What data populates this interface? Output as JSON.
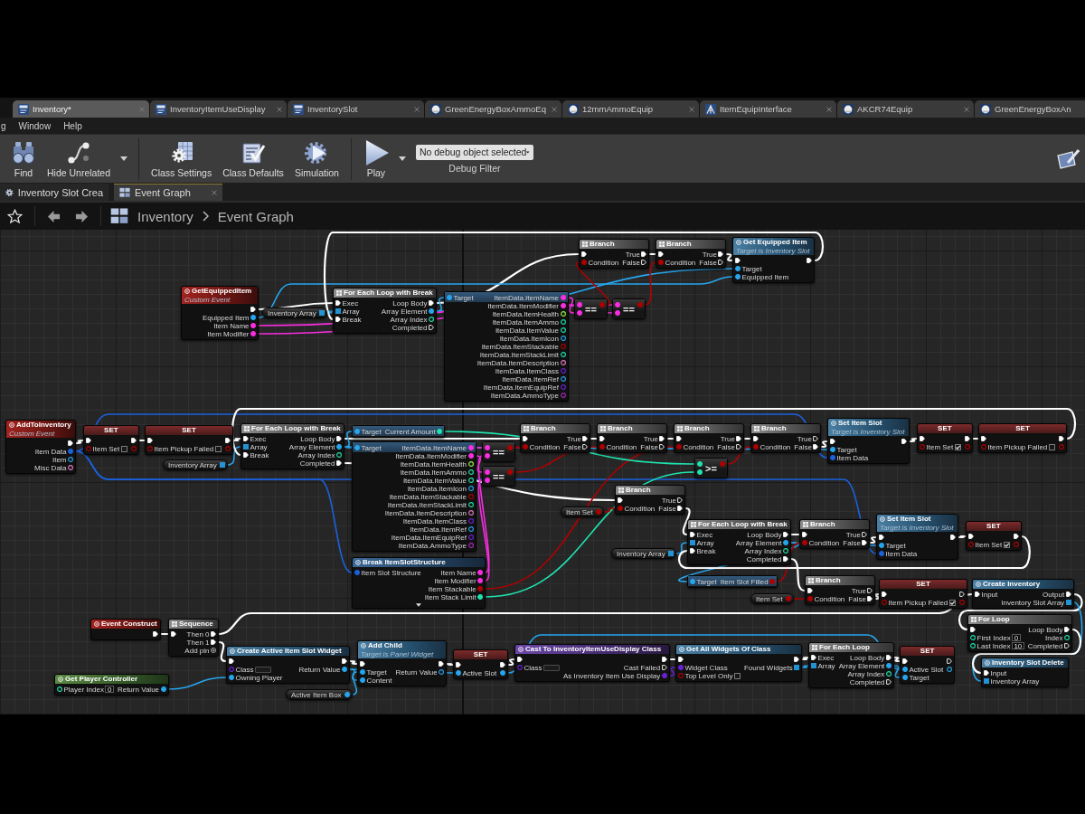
{
  "document_tabs": [
    {
      "label": "Inventory*",
      "kind": "blueprint",
      "selected": true
    },
    {
      "label": "InventoryItemUseDisplay",
      "kind": "blueprint",
      "selected": false
    },
    {
      "label": "InventorySlot",
      "kind": "blueprint",
      "selected": false
    },
    {
      "label": "GreenEnergyBoxAmmoEq",
      "kind": "asset",
      "selected": false
    },
    {
      "label": "12mmAmmoEquip",
      "kind": "asset",
      "selected": false
    },
    {
      "label": "ItemEquipInterface",
      "kind": "interface",
      "selected": false
    },
    {
      "label": "AKCR74Equip",
      "kind": "asset",
      "selected": false
    },
    {
      "label": "GreenEnergyBoxAn",
      "kind": "asset",
      "selected": false
    }
  ],
  "menu": [
    "g",
    "Window",
    "Help"
  ],
  "toolbar": {
    "groups": [
      [
        {
          "kind": "find",
          "label": "Find"
        },
        {
          "kind": "hide-unrelated",
          "label": "Hide Unrelated"
        },
        {
          "kind": "caret"
        }
      ],
      [
        {
          "kind": "class-settings",
          "label": "Class Settings"
        },
        {
          "kind": "class-defaults",
          "label": "Class Defaults"
        },
        {
          "kind": "simulation",
          "label": "Simulation"
        }
      ],
      [
        {
          "kind": "play",
          "label": "Play"
        },
        {
          "kind": "caret"
        }
      ]
    ],
    "debug_filter": {
      "value": "No debug object selected",
      "label": "Debug Filter"
    },
    "trailing": [
      {
        "kind": "edit"
      }
    ]
  },
  "editor_tabs": [
    {
      "label": "Inventory Slot Crea",
      "kind": "function",
      "selected": false
    },
    {
      "label": "Event Graph",
      "kind": "graph",
      "selected": true
    }
  ],
  "breadcrumb": [
    "Inventory",
    "Event Graph"
  ],
  "graph": {
    "nodes": [
      {
        "kind": "flow",
        "title": "Branch",
        "inputs": [
          {
            "kind": "exec",
            "linked": true
          },
          {
            "label": "Condition",
            "kind": "bool",
            "linked": true
          }
        ],
        "outputs": [
          {
            "label": "True",
            "kind": "exec",
            "linked": true
          },
          {
            "label": "False",
            "kind": "exec",
            "linked": false
          }
        ]
      },
      {
        "kind": "flow",
        "title": "Branch",
        "inputs": [
          {
            "kind": "exec",
            "linked": true
          },
          {
            "label": "Condition",
            "kind": "bool",
            "linked": true
          }
        ],
        "outputs": [
          {
            "label": "True",
            "kind": "exec",
            "linked": true
          },
          {
            "label": "False",
            "kind": "exec",
            "linked": false
          }
        ]
      },
      {
        "kind": "function",
        "title": "Get Equipped Item",
        "subtitle": "Target is Inventory Slot",
        "inputs": [
          {
            "kind": "exec",
            "linked": true
          },
          {
            "label": "Target",
            "kind": "object",
            "linked": true
          },
          {
            "label": "Equipped Item",
            "kind": "object",
            "linked": true
          }
        ],
        "outputs": [
          {
            "kind": "exec",
            "linked": true
          }
        ]
      },
      {
        "kind": "event",
        "title": "GetEquippedItem",
        "subtitle": "Custom Event",
        "outputs": [
          {
            "kind": "exec",
            "linked": true
          },
          {
            "label": "Equipped Item",
            "kind": "object",
            "linked": true
          },
          {
            "label": "Item Name",
            "kind": "string",
            "linked": true
          },
          {
            "label": "Item Modifier",
            "kind": "string",
            "linked": true
          }
        ]
      },
      {
        "kind": "getter",
        "title": "Inventory Array",
        "outputs": [
          {
            "kind": "array",
            "linked": true
          }
        ]
      },
      {
        "kind": "flow",
        "title": "For Each Loop with Break",
        "inputs": [
          {
            "label": "Exec",
            "kind": "exec",
            "linked": true
          },
          {
            "label": "Array",
            "kind": "array",
            "linked": true
          },
          {
            "label": "Break",
            "kind": "exec",
            "linked": true
          }
        ],
        "outputs": [
          {
            "label": "Loop Body",
            "kind": "exec",
            "linked": true
          },
          {
            "label": "Array Element",
            "kind": "object",
            "linked": true
          },
          {
            "label": "Array Index",
            "kind": "int",
            "linked": false
          },
          {
            "label": "Completed",
            "kind": "exec",
            "linked": false
          }
        ]
      },
      {
        "kind": "member",
        "inputs": [
          {
            "label": "Target",
            "kind": "object",
            "linked": true
          }
        ],
        "outputs": [
          {
            "label": "ItemData.ItemName",
            "kind": "string",
            "linked": true
          },
          {
            "label": "ItemData.ItemModifier",
            "kind": "string",
            "linked": true
          },
          {
            "label": "ItemData.ItemHealth",
            "kind": "float",
            "linked": false
          },
          {
            "label": "ItemData.ItemAmmo",
            "kind": "int",
            "linked": false
          },
          {
            "label": "ItemData.ItemValue",
            "kind": "int",
            "linked": false
          },
          {
            "label": "ItemData.ItemIcon",
            "kind": "object",
            "linked": false
          },
          {
            "label": "ItemData.ItemStackable",
            "kind": "bool",
            "linked": false
          },
          {
            "label": "ItemData.ItemStackLimit",
            "kind": "int",
            "linked": false
          },
          {
            "label": "ItemData.ItemDescription",
            "kind": "text",
            "linked": false
          },
          {
            "label": "ItemData.ItemClass",
            "kind": "class",
            "linked": false
          },
          {
            "label": "ItemData.ItemRef",
            "kind": "object",
            "linked": false
          },
          {
            "label": "ItemData.ItemEquipRef",
            "kind": "class",
            "linked": false
          },
          {
            "label": "ItemData.AmmoType",
            "kind": "enum",
            "linked": false
          }
        ]
      },
      {
        "kind": "compare",
        "title": "==",
        "inputs": [
          {
            "kind": "string",
            "linked": true
          },
          {
            "kind": "string",
            "linked": true
          }
        ],
        "outputs": [
          {
            "kind": "bool",
            "linked": true
          }
        ]
      },
      {
        "kind": "compare",
        "title": "==",
        "inputs": [
          {
            "kind": "string",
            "linked": true
          },
          {
            "kind": "string",
            "linked": true
          }
        ],
        "outputs": [
          {
            "kind": "bool",
            "linked": true
          }
        ]
      },
      {
        "kind": "event",
        "title": "AddToInventory",
        "subtitle": "Custom Event",
        "outputs": [
          {
            "kind": "exec",
            "linked": true
          },
          {
            "label": "Item Data",
            "kind": "struct",
            "linked": true
          },
          {
            "label": "Item",
            "kind": "object",
            "linked": false
          },
          {
            "label": "Misc Data",
            "kind": "text",
            "linked": false
          }
        ]
      },
      {
        "kind": "set",
        "title": "SET",
        "inputs": [
          {
            "kind": "exec",
            "linked": true
          },
          {
            "label": "Item Set",
            "kind": "bool",
            "linked": false,
            "checked": false
          }
        ],
        "outputs": [
          {
            "kind": "exec",
            "linked": true
          },
          {
            "kind": "bool",
            "linked": false
          }
        ]
      },
      {
        "kind": "set",
        "title": "SET",
        "inputs": [
          {
            "kind": "exec",
            "linked": true
          },
          {
            "label": "Item Pickup Failed",
            "kind": "bool",
            "linked": false,
            "checked": false
          }
        ],
        "outputs": [
          {
            "kind": "exec",
            "linked": true
          },
          {
            "kind": "bool",
            "linked": false
          }
        ]
      },
      {
        "kind": "flow",
        "title": "For Each Loop with Break",
        "inputs": [
          {
            "label": "Exec",
            "kind": "exec",
            "linked": true
          },
          {
            "label": "Array",
            "kind": "array",
            "linked": true
          },
          {
            "label": "Break",
            "kind": "exec",
            "linked": true
          }
        ],
        "outputs": [
          {
            "label": "Loop Body",
            "kind": "exec",
            "linked": true
          },
          {
            "label": "Array Element",
            "kind": "object",
            "linked": true
          },
          {
            "label": "Array Index",
            "kind": "int",
            "linked": false
          },
          {
            "label": "Completed",
            "kind": "exec",
            "linked": true
          }
        ]
      },
      {
        "kind": "member",
        "inputs": [
          {
            "label": "Target",
            "kind": "object",
            "linked": true
          }
        ],
        "outputs": [
          {
            "label": "Current Amount",
            "kind": "int",
            "linked": true
          }
        ]
      },
      {
        "kind": "flow",
        "title": "Branch",
        "inputs": [
          {
            "kind": "exec",
            "linked": true
          },
          {
            "label": "Condition",
            "kind": "bool",
            "linked": true
          }
        ],
        "outputs": [
          {
            "label": "True",
            "kind": "exec",
            "linked": true
          },
          {
            "label": "False",
            "kind": "exec",
            "linked": false
          }
        ]
      },
      {
        "kind": "flow",
        "title": "Branch",
        "inputs": [
          {
            "kind": "exec",
            "linked": true
          },
          {
            "label": "Condition",
            "kind": "bool",
            "linked": true
          }
        ],
        "outputs": [
          {
            "label": "True",
            "kind": "exec",
            "linked": true
          },
          {
            "label": "False",
            "kind": "exec",
            "linked": false
          }
        ]
      },
      {
        "kind": "flow",
        "title": "Branch",
        "inputs": [
          {
            "kind": "exec",
            "linked": true
          },
          {
            "label": "Condition",
            "kind": "bool",
            "linked": true
          }
        ],
        "outputs": [
          {
            "label": "True",
            "kind": "exec",
            "linked": true
          },
          {
            "label": "False",
            "kind": "exec",
            "linked": false
          }
        ]
      },
      {
        "kind": "flow",
        "title": "Branch",
        "inputs": [
          {
            "kind": "exec",
            "linked": true
          },
          {
            "label": "Condition",
            "kind": "bool",
            "linked": true
          }
        ],
        "outputs": [
          {
            "label": "True",
            "kind": "exec",
            "linked": false
          },
          {
            "label": "False",
            "kind": "exec",
            "linked": true
          }
        ]
      },
      {
        "kind": "function",
        "title": "Set Item Slot",
        "subtitle": "Target is Inventory Slot",
        "inputs": [
          {
            "kind": "exec",
            "linked": true
          },
          {
            "label": "Target",
            "kind": "object",
            "linked": true
          },
          {
            "label": "Item Data",
            "kind": "struct",
            "linked": true
          }
        ],
        "outputs": [
          {
            "kind": "exec",
            "linked": true
          }
        ]
      },
      {
        "kind": "set",
        "title": "SET",
        "inputs": [
          {
            "kind": "exec",
            "linked": true
          },
          {
            "label": "Item Set",
            "kind": "bool",
            "linked": false,
            "checked": true
          }
        ],
        "outputs": [
          {
            "kind": "exec",
            "linked": true
          },
          {
            "kind": "bool",
            "linked": false
          }
        ]
      },
      {
        "kind": "set",
        "title": "SET",
        "inputs": [
          {
            "kind": "exec",
            "linked": true
          },
          {
            "label": "Item Pickup Failed",
            "kind": "bool",
            "linked": false,
            "checked": false
          }
        ],
        "outputs": [
          {
            "kind": "exec",
            "linked": true
          },
          {
            "kind": "bool",
            "linked": false
          }
        ]
      },
      {
        "kind": "member",
        "inputs": [
          {
            "label": "Target",
            "kind": "object",
            "linked": true
          }
        ],
        "outputs": [
          {
            "label": "ItemData.ItemName",
            "kind": "string",
            "linked": true
          },
          {
            "label": "ItemData.ItemModifier",
            "kind": "string",
            "linked": true
          },
          {
            "label": "ItemData.ItemHealth",
            "kind": "float",
            "linked": false
          },
          {
            "label": "ItemData.ItemAmmo",
            "kind": "int",
            "linked": false
          },
          {
            "label": "ItemData.ItemValue",
            "kind": "int",
            "linked": false
          },
          {
            "label": "ItemData.ItemIcon",
            "kind": "object",
            "linked": false
          },
          {
            "label": "ItemData.ItemStackable",
            "kind": "bool",
            "linked": false
          },
          {
            "label": "ItemData.ItemStackLimit",
            "kind": "int",
            "linked": false
          },
          {
            "label": "ItemData.ItemDescription",
            "kind": "text",
            "linked": false
          },
          {
            "label": "ItemData.ItemClass",
            "kind": "class",
            "linked": false
          },
          {
            "label": "ItemData.ItemRef",
            "kind": "object",
            "linked": false
          },
          {
            "label": "ItemData.ItemEquipRef",
            "kind": "class",
            "linked": false
          },
          {
            "label": "ItemData.AmmoType",
            "kind": "enum",
            "linked": false
          }
        ]
      },
      {
        "kind": "compare",
        "title": "==",
        "inputs": [
          {
            "kind": "string",
            "linked": true
          },
          {
            "kind": "string",
            "linked": true
          }
        ],
        "outputs": [
          {
            "kind": "bool",
            "linked": true
          }
        ]
      },
      {
        "kind": "getter",
        "title": "Inventory Array",
        "outputs": [
          {
            "kind": "array",
            "linked": true
          }
        ]
      },
      {
        "kind": "compare",
        "title": "==",
        "inputs": [
          {
            "kind": "string",
            "linked": true
          },
          {
            "kind": "string",
            "linked": true
          }
        ],
        "outputs": [
          {
            "kind": "bool",
            "linked": true
          }
        ]
      },
      {
        "kind": "compare",
        "title": ">=",
        "inputs": [
          {
            "kind": "int",
            "linked": true
          },
          {
            "kind": "int",
            "linked": true
          }
        ],
        "outputs": [
          {
            "kind": "bool",
            "linked": true
          }
        ]
      },
      {
        "kind": "flow",
        "title": "Branch",
        "inputs": [
          {
            "kind": "exec",
            "linked": true
          },
          {
            "label": "Condition",
            "kind": "bool",
            "linked": true
          }
        ],
        "outputs": [
          {
            "label": "True",
            "kind": "exec",
            "linked": false
          },
          {
            "label": "False",
            "kind": "exec",
            "linked": true
          }
        ]
      },
      {
        "kind": "getter",
        "title": "Item Set",
        "outputs": [
          {
            "kind": "bool",
            "linked": true
          }
        ]
      },
      {
        "kind": "flow",
        "title": "For Each Loop with Break",
        "inputs": [
          {
            "label": "Exec",
            "kind": "exec",
            "linked": true
          },
          {
            "label": "Array",
            "kind": "array",
            "linked": true
          },
          {
            "label": "Break",
            "kind": "exec",
            "linked": true
          }
        ],
        "outputs": [
          {
            "label": "Loop Body",
            "kind": "exec",
            "linked": true
          },
          {
            "label": "Array Element",
            "kind": "object",
            "linked": true
          },
          {
            "label": "Array Index",
            "kind": "int",
            "linked": false
          },
          {
            "label": "Completed",
            "kind": "exec",
            "linked": true
          }
        ]
      },
      {
        "kind": "flow",
        "title": "Branch",
        "inputs": [
          {
            "kind": "exec",
            "linked": true
          },
          {
            "label": "Condition",
            "kind": "bool",
            "linked": true
          }
        ],
        "outputs": [
          {
            "label": "True",
            "kind": "exec",
            "linked": false
          },
          {
            "label": "False",
            "kind": "exec",
            "linked": true
          }
        ]
      },
      {
        "kind": "function",
        "title": "Set Item Slot",
        "subtitle": "Target is Inventory Slot",
        "inputs": [
          {
            "kind": "exec",
            "linked": true
          },
          {
            "label": "Target",
            "kind": "object",
            "linked": true
          },
          {
            "label": "Item Data",
            "kind": "struct",
            "linked": true
          }
        ],
        "outputs": [
          {
            "kind": "exec",
            "linked": true
          }
        ]
      },
      {
        "kind": "set",
        "title": "SET",
        "inputs": [
          {
            "kind": "exec",
            "linked": true
          },
          {
            "label": "Item Set",
            "kind": "bool",
            "linked": false,
            "checked": true
          }
        ],
        "outputs": [
          {
            "kind": "exec",
            "linked": true
          },
          {
            "kind": "bool",
            "linked": false
          }
        ]
      },
      {
        "kind": "getter",
        "title": "Inventory Array",
        "outputs": [
          {
            "kind": "array",
            "linked": true
          }
        ]
      },
      {
        "kind": "break",
        "title": "Break ItemSlotStructure",
        "inputs": [
          {
            "label": "Item Slot Structure",
            "kind": "struct",
            "linked": true
          }
        ],
        "outputs": [
          {
            "label": "Item Name",
            "kind": "string",
            "linked": true
          },
          {
            "label": "Item Modifier",
            "kind": "string",
            "linked": true
          },
          {
            "label": "Item Stackable",
            "kind": "bool",
            "linked": true
          },
          {
            "label": "Item Stack Limit",
            "kind": "int",
            "linked": true
          }
        ]
      },
      {
        "kind": "member",
        "inputs": [
          {
            "label": "Target",
            "kind": "object",
            "linked": true
          }
        ],
        "outputs": [
          {
            "label": "Item Slot Filled",
            "kind": "bool",
            "linked": true
          }
        ]
      },
      {
        "kind": "getter",
        "title": "Item Set",
        "outputs": [
          {
            "kind": "bool",
            "linked": true
          }
        ]
      },
      {
        "kind": "flow",
        "title": "Branch",
        "inputs": [
          {
            "kind": "exec",
            "linked": true
          },
          {
            "label": "Condition",
            "kind": "bool",
            "linked": true
          }
        ],
        "outputs": [
          {
            "label": "True",
            "kind": "exec",
            "linked": false
          },
          {
            "label": "False",
            "kind": "exec",
            "linked": true
          }
        ]
      },
      {
        "kind": "set",
        "title": "SET",
        "inputs": [
          {
            "kind": "exec",
            "linked": true
          },
          {
            "label": "Item Pickup Failed",
            "kind": "bool",
            "linked": false,
            "checked": true
          }
        ],
        "outputs": [
          {
            "kind": "exec",
            "linked": false
          },
          {
            "kind": "bool",
            "linked": false
          }
        ]
      },
      {
        "kind": "function",
        "title": "Create Inventory",
        "inputs": [
          {
            "label": "Input",
            "kind": "exec",
            "linked": true
          }
        ],
        "outputs": [
          {
            "label": "Output",
            "kind": "exec",
            "linked": true
          },
          {
            "label": "Inventory Slot Array",
            "kind": "array",
            "linked": true
          }
        ]
      },
      {
        "kind": "event",
        "title": "Event Construct",
        "outputs": [
          {
            "kind": "exec",
            "linked": true
          }
        ]
      },
      {
        "kind": "flow",
        "title": "Sequence",
        "inputs": [
          {
            "kind": "exec",
            "linked": true
          }
        ],
        "outputs": [
          {
            "label": "Then 0",
            "kind": "exec",
            "linked": true
          },
          {
            "label": "Then 1",
            "kind": "exec",
            "linked": true
          },
          {
            "label": "Add pin",
            "kind": "add"
          }
        ]
      },
      {
        "kind": "flow",
        "title": "For Loop",
        "inputs": [
          {
            "kind": "exec",
            "linked": true
          },
          {
            "label": "First Index",
            "kind": "int",
            "linked": false,
            "value": "0"
          },
          {
            "label": "Last Index",
            "kind": "int",
            "linked": false,
            "value": "10"
          }
        ],
        "outputs": [
          {
            "label": "Loop Body",
            "kind": "exec",
            "linked": true
          },
          {
            "label": "Index",
            "kind": "int",
            "linked": false
          },
          {
            "label": "Completed",
            "kind": "exec",
            "linked": false
          }
        ]
      },
      {
        "kind": "function",
        "title": "Create Active Item Slot Widget",
        "inputs": [
          {
            "kind": "exec",
            "linked": true
          },
          {
            "label": "Class",
            "kind": "class",
            "linked": false
          },
          {
            "label": "Owning Player",
            "kind": "object",
            "linked": true
          }
        ],
        "outputs": [
          {
            "kind": "exec",
            "linked": true
          },
          {
            "label": "Return Value",
            "kind": "object",
            "linked": true
          }
        ]
      },
      {
        "kind": "function",
        "title": "Add Child",
        "subtitle": "Target is Panel Widget",
        "inputs": [
          {
            "kind": "exec",
            "linked": true
          },
          {
            "label": "Target",
            "kind": "object",
            "linked": true
          },
          {
            "label": "Content",
            "kind": "object",
            "linked": true
          }
        ],
        "outputs": [
          {
            "kind": "exec",
            "linked": true
          },
          {
            "label": "Return Value",
            "kind": "object",
            "linked": false
          }
        ]
      },
      {
        "kind": "set",
        "title": "SET",
        "inputs": [
          {
            "kind": "exec",
            "linked": true
          },
          {
            "label": "Active Slot",
            "kind": "object",
            "linked": true
          }
        ],
        "outputs": [
          {
            "kind": "exec",
            "linked": true
          },
          {
            "kind": "object",
            "linked": true
          }
        ]
      },
      {
        "kind": "cast",
        "title": "Cast To InventoryItemUseDisplay Class",
        "inputs": [
          {
            "kind": "exec",
            "linked": true
          },
          {
            "label": "Class",
            "kind": "class",
            "linked": false
          }
        ],
        "outputs": [
          {
            "kind": "exec",
            "linked": true
          },
          {
            "label": "Cast Failed",
            "kind": "exec",
            "linked": false
          },
          {
            "label": "As Inventory Item Use Display",
            "kind": "class",
            "linked": true
          }
        ]
      },
      {
        "kind": "function",
        "title": "Get All Widgets Of Class",
        "inputs": [
          {
            "kind": "exec",
            "linked": true
          },
          {
            "label": "Widget Class",
            "kind": "class",
            "linked": true
          },
          {
            "label": "Top Level Only",
            "kind": "bool",
            "linked": false,
            "checked": false
          }
        ],
        "outputs": [
          {
            "kind": "exec",
            "linked": true
          },
          {
            "label": "Found Widgets",
            "kind": "array",
            "linked": true
          }
        ]
      },
      {
        "kind": "flow",
        "title": "For Each Loop",
        "inputs": [
          {
            "label": "Exec",
            "kind": "exec",
            "linked": true
          },
          {
            "label": "Array",
            "kind": "array",
            "linked": true
          }
        ],
        "outputs": [
          {
            "label": "Loop Body",
            "kind": "exec",
            "linked": true
          },
          {
            "label": "Array Element",
            "kind": "object",
            "linked": true
          },
          {
            "label": "Array Index",
            "kind": "int",
            "linked": false
          },
          {
            "label": "Completed",
            "kind": "exec",
            "linked": false
          }
        ]
      },
      {
        "kind": "set",
        "title": "SET",
        "inputs": [
          {
            "kind": "exec",
            "linked": true
          },
          {
            "label": "Active Slot",
            "kind": "object",
            "linked": true
          },
          {
            "label": "Target",
            "kind": "object",
            "linked": true
          }
        ],
        "outputs": [
          {
            "kind": "exec",
            "linked": false
          },
          {
            "kind": "object",
            "linked": false
          }
        ]
      },
      {
        "kind": "function",
        "title": "Inventory Slot Delete",
        "inputs": [
          {
            "label": "Input",
            "kind": "exec",
            "linked": true
          },
          {
            "label": "Inventory Array",
            "kind": "array",
            "linked": true
          }
        ]
      },
      {
        "kind": "pure",
        "title": "Get Player Controller",
        "inputs": [
          {
            "label": "Player Index",
            "kind": "int",
            "linked": false,
            "value": "0"
          }
        ],
        "outputs": [
          {
            "label": "Return Value",
            "kind": "object",
            "linked": true
          }
        ]
      },
      {
        "kind": "getter",
        "title": "Active Item Box",
        "outputs": [
          {
            "kind": "object",
            "linked": true
          }
        ]
      }
    ]
  }
}
